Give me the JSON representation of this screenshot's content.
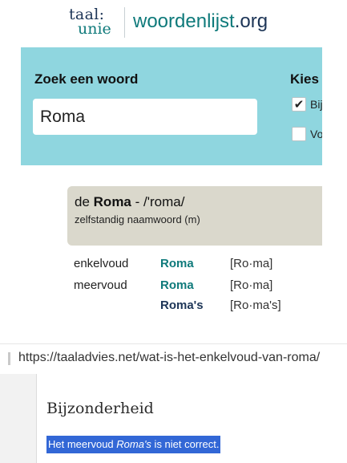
{
  "header": {
    "logo_line1": "taal:",
    "logo_line2": "unie",
    "site_name": "woordenlijst",
    "site_tld": ".org"
  },
  "search": {
    "heading": "Zoek een woord",
    "value": "Roma",
    "placeholder": ""
  },
  "options": {
    "heading": "Kies",
    "items": [
      {
        "label": "Bij",
        "checked": true
      },
      {
        "label": "Vo",
        "checked": false
      }
    ]
  },
  "result": {
    "article": "de",
    "word": "Roma",
    "pronunciation": "- /'roma/",
    "part_of_speech": "zelfstandig naamwoord (m)"
  },
  "inflections": [
    {
      "label": "enkelvoud",
      "form": "Roma",
      "hyphenation": "[Ro·ma]"
    },
    {
      "label": "meervoud",
      "form": "Roma",
      "hyphenation": "[Ro·ma]"
    },
    {
      "label": "",
      "form": "Roma's",
      "hyphenation": "[Ro·ma's]"
    }
  ],
  "browser": {
    "url": "https://taaladvies.net/wat-is-het-enkelvoud-van-roma/"
  },
  "article": {
    "title": "Bijzonderheid",
    "highlight_before": "Het meervoud ",
    "highlight_word": "Roma's",
    "highlight_after": " is niet correct."
  },
  "colors": {
    "brand_teal": "#0f7a7b",
    "brand_navy": "#1d3557",
    "search_panel": "#8fd6df",
    "result_box": "#dad8cc",
    "selection": "#3267d6"
  },
  "icons": {
    "checkbox_checked": "checkmark-icon"
  }
}
